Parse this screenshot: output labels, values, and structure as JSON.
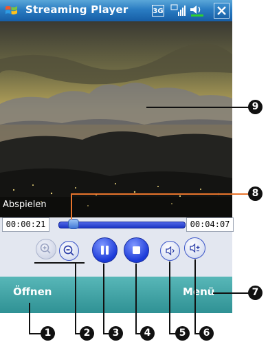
{
  "titlebar": {
    "title": "Streaming Player",
    "network": "3G"
  },
  "player": {
    "status": "Abspielen",
    "time_current": "00:00:21",
    "time_total": "00:04:07",
    "progress_fraction": 0.08
  },
  "softkeys": {
    "left": "Öffnen",
    "right": "Menü"
  },
  "callouts": [
    "1",
    "2",
    "3",
    "4",
    "5",
    "6",
    "7",
    "8",
    "9"
  ],
  "colors": {
    "title_bar": "#1f6fb5",
    "softkey_bar": "#3aa3a5",
    "seek_bar": "#2c46d6"
  }
}
